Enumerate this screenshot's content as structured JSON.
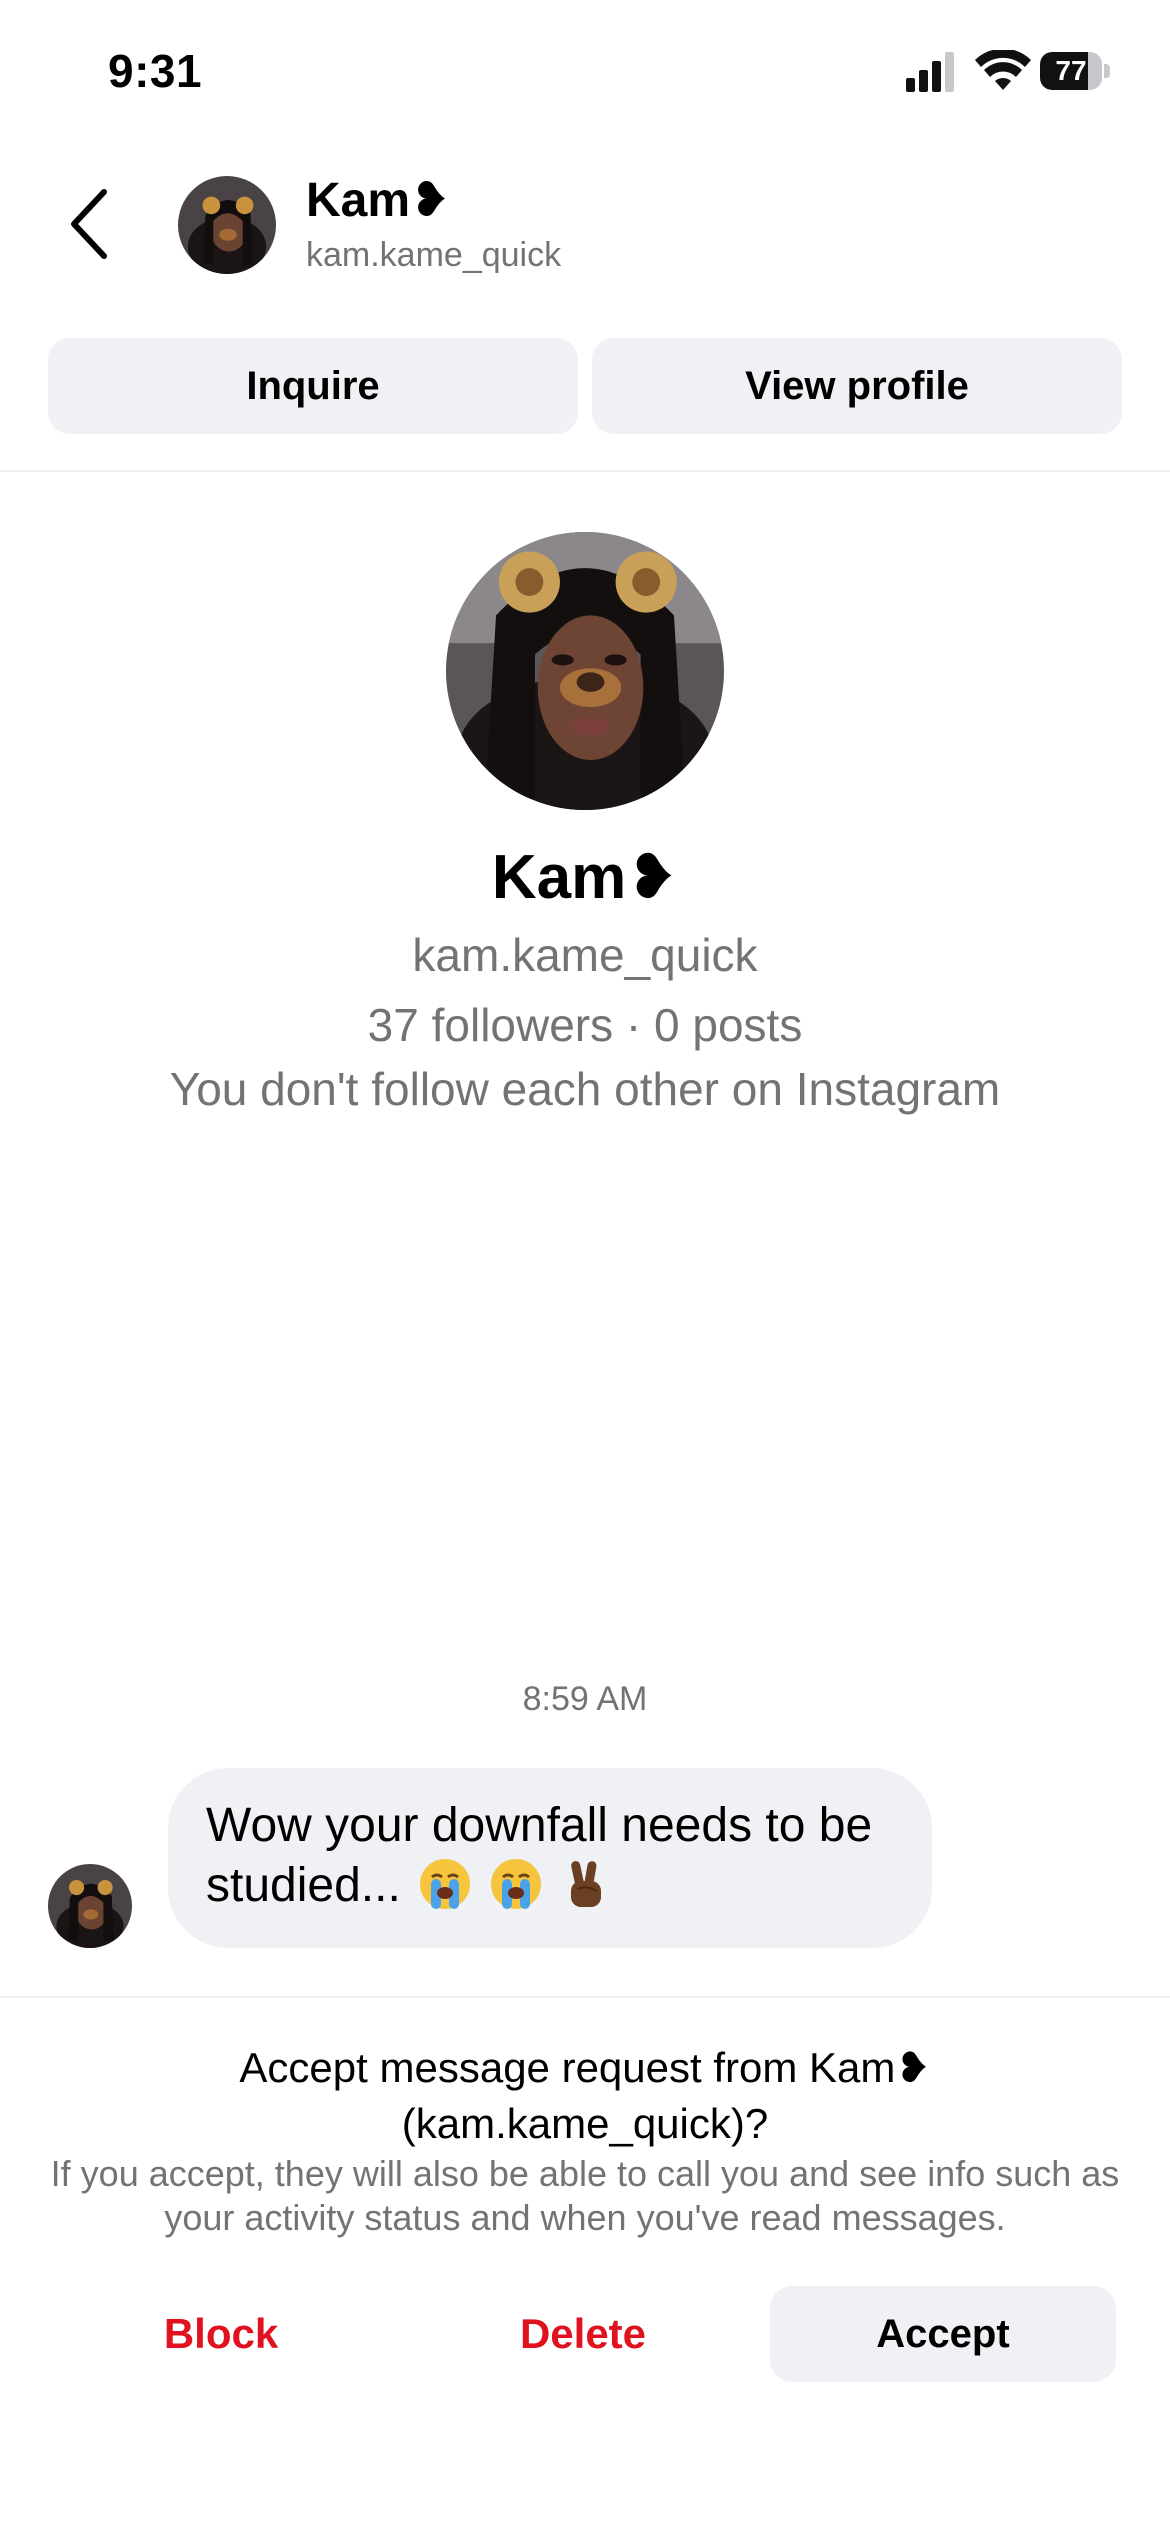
{
  "status_bar": {
    "time": "9:31",
    "battery_percent": "77",
    "battery_level": 0.77,
    "icons": [
      "cellular-signal-icon",
      "wifi-icon",
      "battery-icon"
    ]
  },
  "header": {
    "back_icon": "chevron-left-icon",
    "name": "Kam❥",
    "handle": "kam.kame_quick"
  },
  "actions_top": {
    "inquire_label": "Inquire",
    "view_profile_label": "View profile"
  },
  "profile": {
    "name": "Kam❥",
    "handle": "kam.kame_quick",
    "stats": "37 followers · 0 posts",
    "mutual_status": "You don't follow each other on Instagram"
  },
  "conversation": {
    "timestamp": "8:59 AM",
    "message_text": "Wow your downfall needs to be studied...",
    "message_emojis": [
      "crying-face-emoji",
      "crying-face-emoji",
      "victory-hand-emoji"
    ]
  },
  "request_panel": {
    "title": "Accept message request from Kam❥ (kam.kame_quick)?",
    "description": "If you accept, they will also be able to call you and see info such as your activity status and when you've read messages.",
    "block_label": "Block",
    "delete_label": "Delete",
    "accept_label": "Accept"
  },
  "colors": {
    "accent_danger": "#e0121f",
    "secondary_text": "#737373",
    "button_bg": "#eff1f4"
  }
}
